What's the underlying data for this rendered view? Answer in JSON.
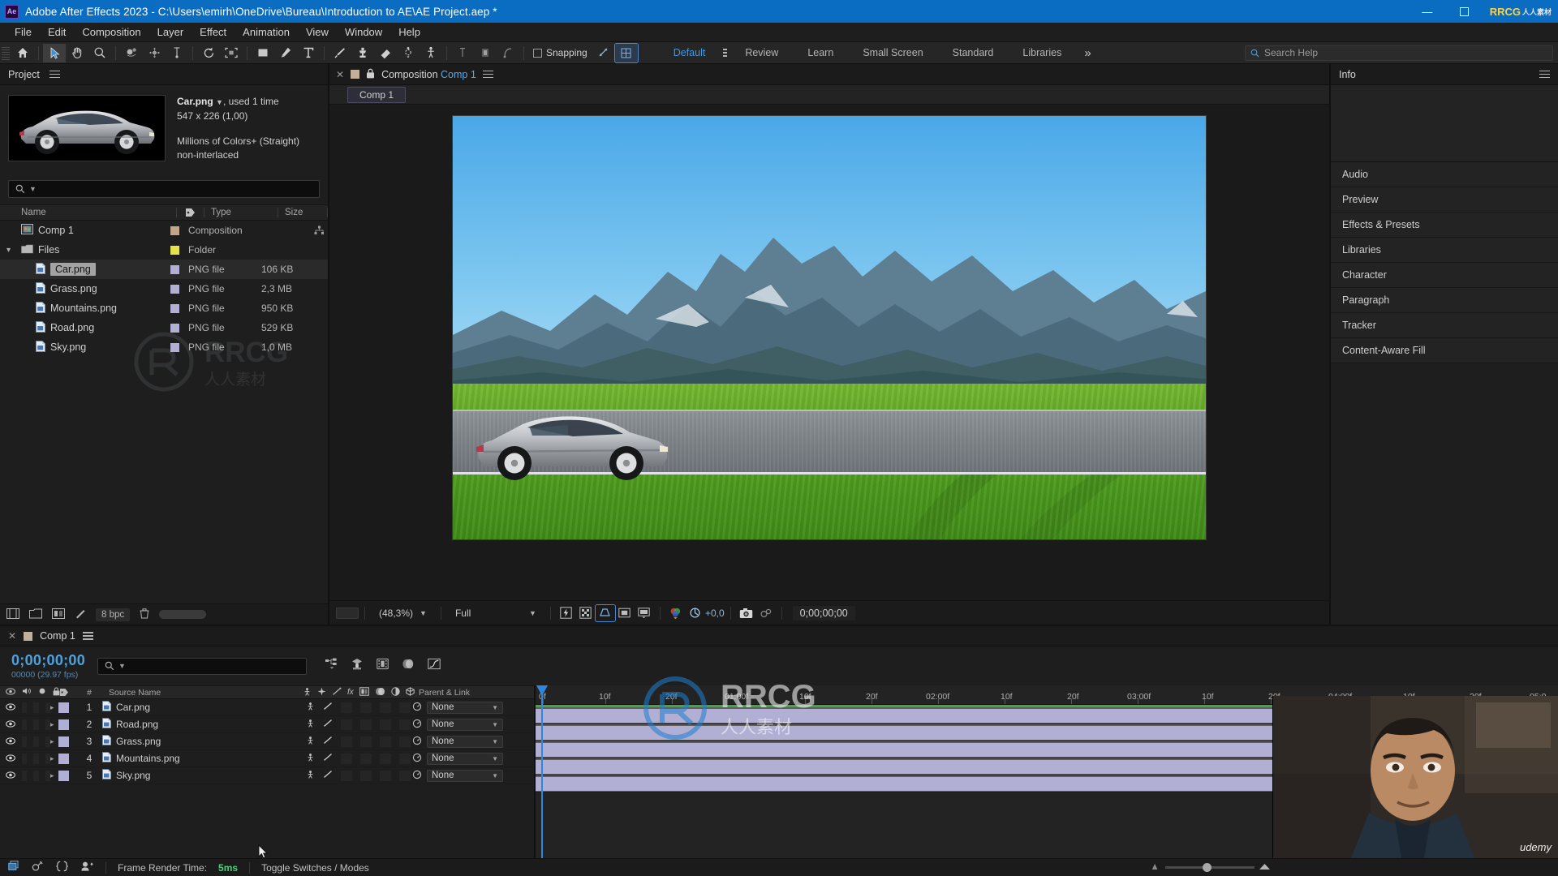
{
  "titlebar": {
    "app_icon": "ae-logo-icon",
    "title": "Adobe After Effects 2023 - C:\\Users\\emirh\\OneDrive\\Bureau\\Introduction to AE\\AE Project.aep *",
    "minimize": "—",
    "maximize": "❐",
    "close": "✕",
    "watermark": "RRCG",
    "watermark_cn": "人人素材"
  },
  "menubar": {
    "items": [
      "File",
      "Edit",
      "Composition",
      "Layer",
      "Effect",
      "Animation",
      "View",
      "Window",
      "Help"
    ]
  },
  "toolbar": {
    "tools": [
      {
        "name": "home-icon",
        "label": "Home"
      },
      {
        "name": "selection-tool-icon",
        "label": "Selection Tool",
        "active": true
      },
      {
        "name": "hand-tool-icon",
        "label": "Hand Tool"
      },
      {
        "name": "zoom-tool-icon",
        "label": "Zoom Tool"
      },
      {
        "name": "orbit-tool-icon",
        "label": "Orbit Around Cursor"
      },
      {
        "name": "pan-under-cursor-icon",
        "label": "Pan Under Cursor"
      },
      {
        "name": "dolly-tool-icon",
        "label": "Dolly Towards Cursor"
      },
      {
        "name": "rotation-tool-icon",
        "label": "Rotation Tool"
      },
      {
        "name": "anchor-point-tool-icon",
        "label": "Pan Behind Tool"
      },
      {
        "name": "shape-tool-icon",
        "label": "Rectangle Tool"
      },
      {
        "name": "pen-tool-icon",
        "label": "Pen Tool"
      },
      {
        "name": "type-tool-icon",
        "label": "Type Tool"
      },
      {
        "name": "brush-tool-icon",
        "label": "Brush Tool"
      },
      {
        "name": "clone-stamp-tool-icon",
        "label": "Clone Stamp Tool"
      },
      {
        "name": "eraser-tool-icon",
        "label": "Eraser Tool"
      },
      {
        "name": "roto-brush-tool-icon",
        "label": "Roto Brush Tool"
      },
      {
        "name": "puppet-pin-tool-icon",
        "label": "Puppet Pin Tool"
      }
    ],
    "extra_tools": [
      {
        "name": "puppet-starch-icon",
        "label": "Puppet Starch Tool"
      },
      {
        "name": "puppet-overlap-icon",
        "label": "Puppet Overlap Tool"
      },
      {
        "name": "puppet-bend-icon",
        "label": "Puppet Bend Tool"
      }
    ],
    "snapping_label": "Snapping",
    "snapping_checked": false,
    "align_icon": "align-icon",
    "grid_icon": "grid-icon"
  },
  "workspaces": {
    "items": [
      {
        "label": "Default",
        "selected": true
      },
      {
        "label": "Review",
        "selected": false
      },
      {
        "label": "Learn",
        "selected": false
      },
      {
        "label": "Small Screen",
        "selected": false
      },
      {
        "label": "Standard",
        "selected": false
      },
      {
        "label": "Libraries",
        "selected": false
      }
    ],
    "menu_icon": "workspace-menu-icon",
    "more_icon": "chevron-double-right-icon",
    "search_placeholder": "Search Help",
    "search_icon": "search-icon"
  },
  "project_panel": {
    "tab_label": "Project",
    "menu_icon": "panel-menu-icon",
    "preview": {
      "thumbnail": "car-thumbnail",
      "file_name": "Car.png",
      "dropdown_icon": "chevron-down-icon",
      "usage": ", used 1 time",
      "dimensions": "547 x 226 (1,00)",
      "color_info": "Millions of Colors+ (Straight)",
      "interlace": "non-interlaced"
    },
    "search_placeholder": "",
    "search_icon": "search-icon",
    "columns": {
      "name": "Name",
      "tag": "label-tag-icon",
      "type": "Type",
      "size": "Size",
      "sort_direction": "ascending"
    },
    "rows": [
      {
        "name": "Comp 1",
        "icon": "composition-icon",
        "tag_color": "#c3a58a",
        "type": "Composition",
        "size": "",
        "indent": 1,
        "selected": false,
        "disclosure": ""
      },
      {
        "name": "Files",
        "icon": "folder-icon",
        "tag_color": "#e6e04a",
        "type": "Folder",
        "size": "",
        "indent": 1,
        "selected": false,
        "disclosure": "open"
      },
      {
        "name": "Car.png",
        "icon": "png-file-icon",
        "tag_color": "#b1afd4",
        "type": "PNG file",
        "size": "106 KB",
        "indent": 2,
        "selected": true,
        "disclosure": ""
      },
      {
        "name": "Grass.png",
        "icon": "png-file-icon",
        "tag_color": "#b1afd4",
        "type": "PNG file",
        "size": "2,3 MB",
        "indent": 2,
        "selected": false,
        "disclosure": ""
      },
      {
        "name": "Mountains.png",
        "icon": "png-file-icon",
        "tag_color": "#b1afd4",
        "type": "PNG file",
        "size": "950 KB",
        "indent": 2,
        "selected": false,
        "disclosure": ""
      },
      {
        "name": "Road.png",
        "icon": "png-file-icon",
        "tag_color": "#b1afd4",
        "type": "PNG file",
        "size": "529 KB",
        "indent": 2,
        "selected": false,
        "disclosure": ""
      },
      {
        "name": "Sky.png",
        "icon": "png-file-icon",
        "tag_color": "#b1afd4",
        "type": "PNG file",
        "size": "1,0 MB",
        "indent": 2,
        "selected": false,
        "disclosure": ""
      }
    ],
    "footer": {
      "bit_depth": "8 bpc",
      "icons": [
        "new-comp-icon",
        "new-folder-icon",
        "project-settings-icon",
        "color-depth-icon",
        "delete-icon"
      ]
    }
  },
  "composition_panel": {
    "close_icon": "close-icon",
    "swatch": "comp-swatch",
    "lock_icon": "lock-icon",
    "title_prefix": "Composition",
    "title_name": "Comp 1",
    "menu_icon": "panel-menu-icon",
    "subtab": "Comp 1",
    "controls": {
      "magnification": "(48,3%)",
      "resolution": "Full",
      "timecode": "0;00;00;00",
      "exposure": "+0,0",
      "buttons": [
        {
          "name": "fast-previews-icon",
          "active": false
        },
        {
          "name": "transparency-grid-icon",
          "active": false
        },
        {
          "name": "region-of-interest-icon",
          "active": true
        },
        {
          "name": "title-action-safe-icon",
          "active": false
        },
        {
          "name": "show-channel-icon",
          "active": false
        },
        {
          "name": "color-management-icon",
          "active": false
        },
        {
          "name": "reset-exposure-icon",
          "active": false
        },
        {
          "name": "take-snapshot-icon",
          "active": false
        },
        {
          "name": "show-snapshot-icon",
          "active": false
        }
      ]
    }
  },
  "right_dock": {
    "tab_label": "Info",
    "menu_icon": "panel-menu-icon",
    "panels": [
      "Audio",
      "Preview",
      "Effects & Presets",
      "Libraries",
      "Character",
      "Paragraph",
      "Tracker",
      "Content-Aware Fill"
    ]
  },
  "timeline": {
    "close_icon": "close-icon",
    "swatch": "comp-swatch",
    "tab_label": "Comp 1",
    "menu_icon": "panel-menu-icon",
    "timecode": "0;00;00;00",
    "frame_info": "00000 (29.97 fps)",
    "search_placeholder": "",
    "search_icon": "search-icon",
    "header_icons": [
      "composition-mini-flowchart-icon",
      "draft-3d-icon",
      "hide-shy-layers-icon",
      "frame-blending-icon",
      "motion-blur-icon",
      "graph-editor-icon"
    ],
    "columns": {
      "eye": "video-icon",
      "audio": "audio-icon",
      "solo": "solo-icon",
      "lock": "lock-icon",
      "tag": "label-tag-icon",
      "number": "#",
      "source_name": "Source Name",
      "switches": [
        "shy-icon",
        "collapse-transformations-icon",
        "quality-icon",
        "fx-icon",
        "frame-blend-icon",
        "motion-blur-icon",
        "adjustment-layer-icon",
        "3d-layer-icon"
      ],
      "parent": "Parent & Link"
    },
    "layers": [
      {
        "index": "1",
        "name": "Car.png",
        "label_color": "#b1afd4",
        "parent": "None"
      },
      {
        "index": "2",
        "name": "Road.png",
        "label_color": "#b1afd4",
        "parent": "None"
      },
      {
        "index": "3",
        "name": "Grass.png",
        "label_color": "#b1afd4",
        "parent": "None"
      },
      {
        "index": "4",
        "name": "Mountains.png",
        "label_color": "#b1afd4",
        "parent": "None"
      },
      {
        "index": "5",
        "name": "Sky.png",
        "label_color": "#b1afd4",
        "parent": "None"
      }
    ],
    "ruler_ticks": [
      "0f",
      "10f",
      "20f",
      "01:00f",
      "10f",
      "20f",
      "02:00f",
      "10f",
      "20f",
      "03:00f",
      "10f",
      "20f",
      "04:00f",
      "10f",
      "20f",
      "05:0"
    ],
    "footer": {
      "toggle_icons": [
        "comp-renderer-icon",
        "auto-keyframe-icon",
        "expression-icon",
        "motion-graphics-icon"
      ],
      "render_time_label": "Frame Render Time:",
      "render_time_value": "5ms",
      "switches_modes": "Toggle Switches / Modes"
    }
  },
  "watermark": {
    "text": "RRCG",
    "subtext": "人人素材"
  },
  "webcam": {
    "brand": "udemy"
  },
  "colors": {
    "accent_blue": "#0a6dc2",
    "link_blue": "#5aa9e6",
    "panel_bg": "#1e1e1e",
    "label_purple": "#b1afd4",
    "green": "#4ad07a"
  }
}
